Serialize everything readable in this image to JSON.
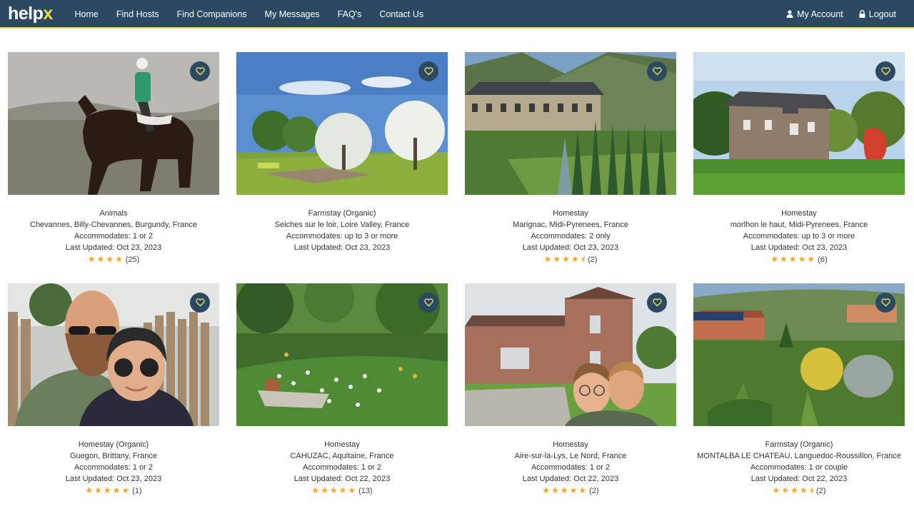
{
  "nav": {
    "logo_main": "help",
    "logo_accent": "x",
    "links": [
      "Home",
      "Find Hosts",
      "Find Companions",
      "My Messages",
      "FAQ's",
      "Contact Us"
    ],
    "account": "My Account",
    "logout": "Logout"
  },
  "colors": {
    "navbar": "#2c4964",
    "accent": "#e6e046",
    "stars": "#f5a623"
  },
  "listings": [
    {
      "type": "Animals",
      "location": "Chevannes, Billy-Chevannes, Burgundy, France",
      "accommodates": "Accommodates: 1 or 2",
      "updated": "Last Updated: Oct 23, 2023",
      "rating": 4,
      "reviews": "(25)"
    },
    {
      "type": "Farmstay (Organic)",
      "location": "Seiches sur le loir, Loire Valley, France",
      "accommodates": "Accommodates: up to 3 or more",
      "updated": "Last Updated: Oct 23, 2023",
      "rating": 0,
      "reviews": ""
    },
    {
      "type": "Homestay",
      "location": "Marignac, Midi-Pyrenees, France",
      "accommodates": "Accommodates: 2 only",
      "updated": "Last Updated: Oct 23, 2023",
      "rating": 4.5,
      "reviews": "(2)"
    },
    {
      "type": "Homestay",
      "location": "morlhon le haut, Midi-Pyrenees, France",
      "accommodates": "Accommodates: up to 3 or more",
      "updated": "Last Updated: Oct 23, 2023",
      "rating": 5,
      "reviews": "(6)"
    },
    {
      "type": "Homestay (Organic)",
      "location": "Guegon, Brittany, France",
      "accommodates": "Accommodates: 1 or 2",
      "updated": "Last Updated: Oct 23, 2023",
      "rating": 5,
      "reviews": "(1)"
    },
    {
      "type": "Homestay",
      "location": "CAHUZAC, Aquitaine, France",
      "accommodates": "Accommodates: 1 or 2",
      "updated": "Last Updated: Oct 22, 2023",
      "rating": 5,
      "reviews": "(13)"
    },
    {
      "type": "Homestay",
      "location": "Aire-sur-la-Lys, Le Nord, France",
      "accommodates": "Accommodates: 1 or 2",
      "updated": "Last Updated: Oct 22, 2023",
      "rating": 5,
      "reviews": "(2)"
    },
    {
      "type": "Farmstay (Organic)",
      "location": "MONTALBA LE CHATEAU, Languedoc-Roussillon, France",
      "accommodates": "Accommodates: 1 or couple",
      "updated": "Last Updated: Oct 22, 2023",
      "rating": 4.5,
      "reviews": "(2)"
    }
  ]
}
